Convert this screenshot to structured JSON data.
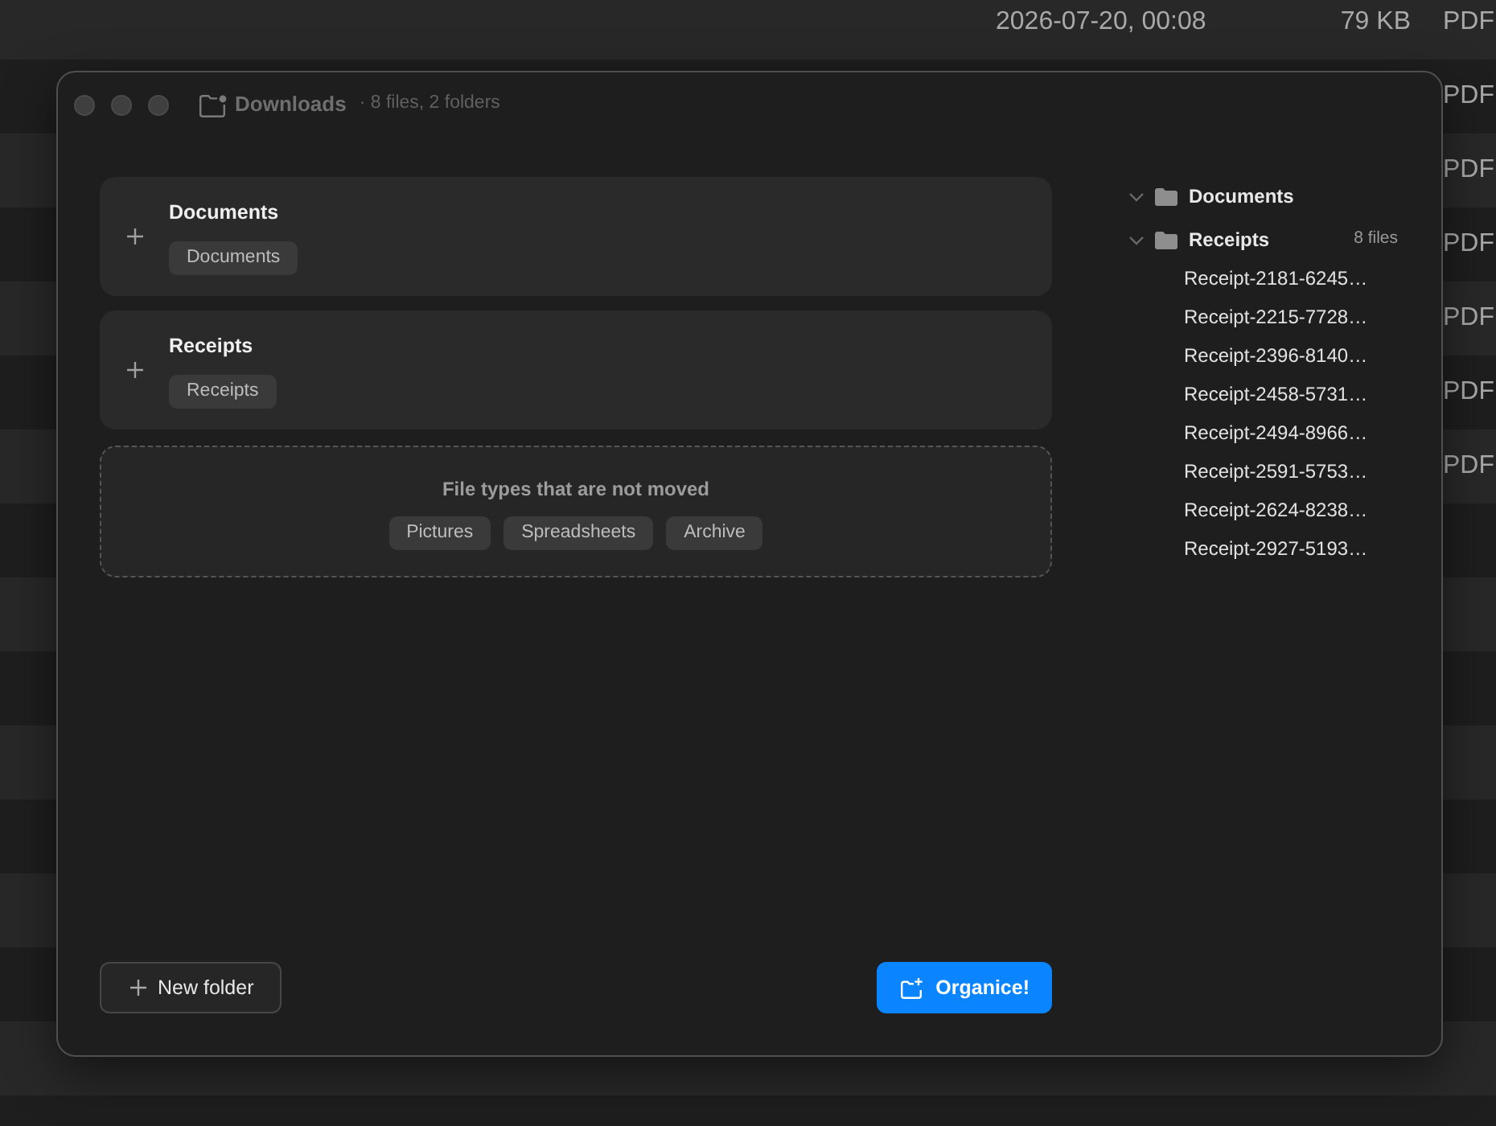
{
  "background_list": {
    "rows": [
      {
        "date": "2026-07-20, 00:08",
        "size": "79 KB",
        "kind": "PDF"
      },
      {
        "kind": "PDF"
      },
      {
        "kind": "PDF"
      },
      {
        "kind": "PDF"
      },
      {
        "kind": "PDF"
      },
      {
        "kind": "PDF"
      },
      {
        "kind": "PDF"
      }
    ]
  },
  "window": {
    "title": "Downloads",
    "subtitle": "· 8 files, 2 folders"
  },
  "rules": [
    {
      "title": "Documents",
      "tags": [
        "Documents"
      ]
    },
    {
      "title": "Receipts",
      "tags": [
        "Receipts"
      ]
    }
  ],
  "excluded": {
    "title": "File types that are not moved",
    "tags": [
      "Pictures",
      "Spreadsheets",
      "Archive"
    ]
  },
  "preview_tree": [
    {
      "name": "Documents",
      "expanded": true
    },
    {
      "name": "Receipts",
      "expanded": true,
      "count": "8 files",
      "children": [
        {
          "name": "Receipt-2181-6245…"
        },
        {
          "name": "Receipt-2215-7728…"
        },
        {
          "name": "Receipt-2396-8140…"
        },
        {
          "name": "Receipt-2458-5731…"
        },
        {
          "name": "Receipt-2494-8966…"
        },
        {
          "name": "Receipt-2591-5753…"
        },
        {
          "name": "Receipt-2624-8238…"
        },
        {
          "name": "Receipt-2927-5193…"
        }
      ]
    }
  ],
  "buttons": {
    "new_folder": "New folder",
    "organize": "Organice!"
  }
}
